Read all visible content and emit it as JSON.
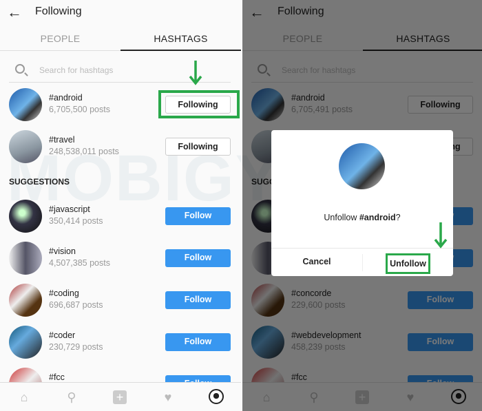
{
  "watermark": "MOBIGYAAN",
  "accent": "#3897f0",
  "highlight": "#2aa84a",
  "left": {
    "header": {
      "title": "Following",
      "back_icon": "arrow-left-icon"
    },
    "tabs": [
      {
        "label": "PEOPLE"
      },
      {
        "label": "HASHTAGS",
        "active": true
      }
    ],
    "search": {
      "placeholder": "Search for hashtags"
    },
    "following": [
      {
        "name": "#android",
        "posts": "6,705,500 posts",
        "button": "Following"
      },
      {
        "name": "#travel",
        "posts": "248,538,011 posts",
        "button": "Following"
      }
    ],
    "suggestions_label": "SUGGESTIONS",
    "suggestions": [
      {
        "name": "#javascript",
        "posts": "350,414 posts",
        "button": "Follow"
      },
      {
        "name": "#vision",
        "posts": "4,507,385 posts",
        "button": "Follow"
      },
      {
        "name": "#coding",
        "posts": "696,687 posts",
        "button": "Follow"
      },
      {
        "name": "#coder",
        "posts": "230,729 posts",
        "button": "Follow"
      },
      {
        "name": "#fcc",
        "posts": "",
        "button": "Follow"
      }
    ]
  },
  "right": {
    "header": {
      "title": "Following",
      "back_icon": "arrow-left-icon"
    },
    "tabs": [
      {
        "label": "PEOPLE"
      },
      {
        "label": "HASHTAGS",
        "active": true
      }
    ],
    "search": {
      "placeholder": "Search for hashtags"
    },
    "following": [
      {
        "name": "#android",
        "posts": "6,705,491 posts",
        "button": "Following"
      },
      {
        "name": "",
        "posts": "",
        "button": "Following"
      }
    ],
    "suggestions_label": "SUGGESTIONS",
    "suggestions": [
      {
        "name": "",
        "posts": "",
        "button": "Follow"
      },
      {
        "name": "",
        "posts": "",
        "button": "Follow"
      },
      {
        "name": "#concorde",
        "posts": "229,600 posts",
        "button": "Follow"
      },
      {
        "name": "#webdevelopment",
        "posts": "458,239 posts",
        "button": "Follow"
      },
      {
        "name": "#fcc",
        "posts": "",
        "button": "Follow"
      }
    ],
    "dialog": {
      "prompt_prefix": "Unfollow ",
      "prompt_tag": "#android",
      "prompt_suffix": "?",
      "cancel": "Cancel",
      "unfollow": "Unfollow"
    }
  }
}
